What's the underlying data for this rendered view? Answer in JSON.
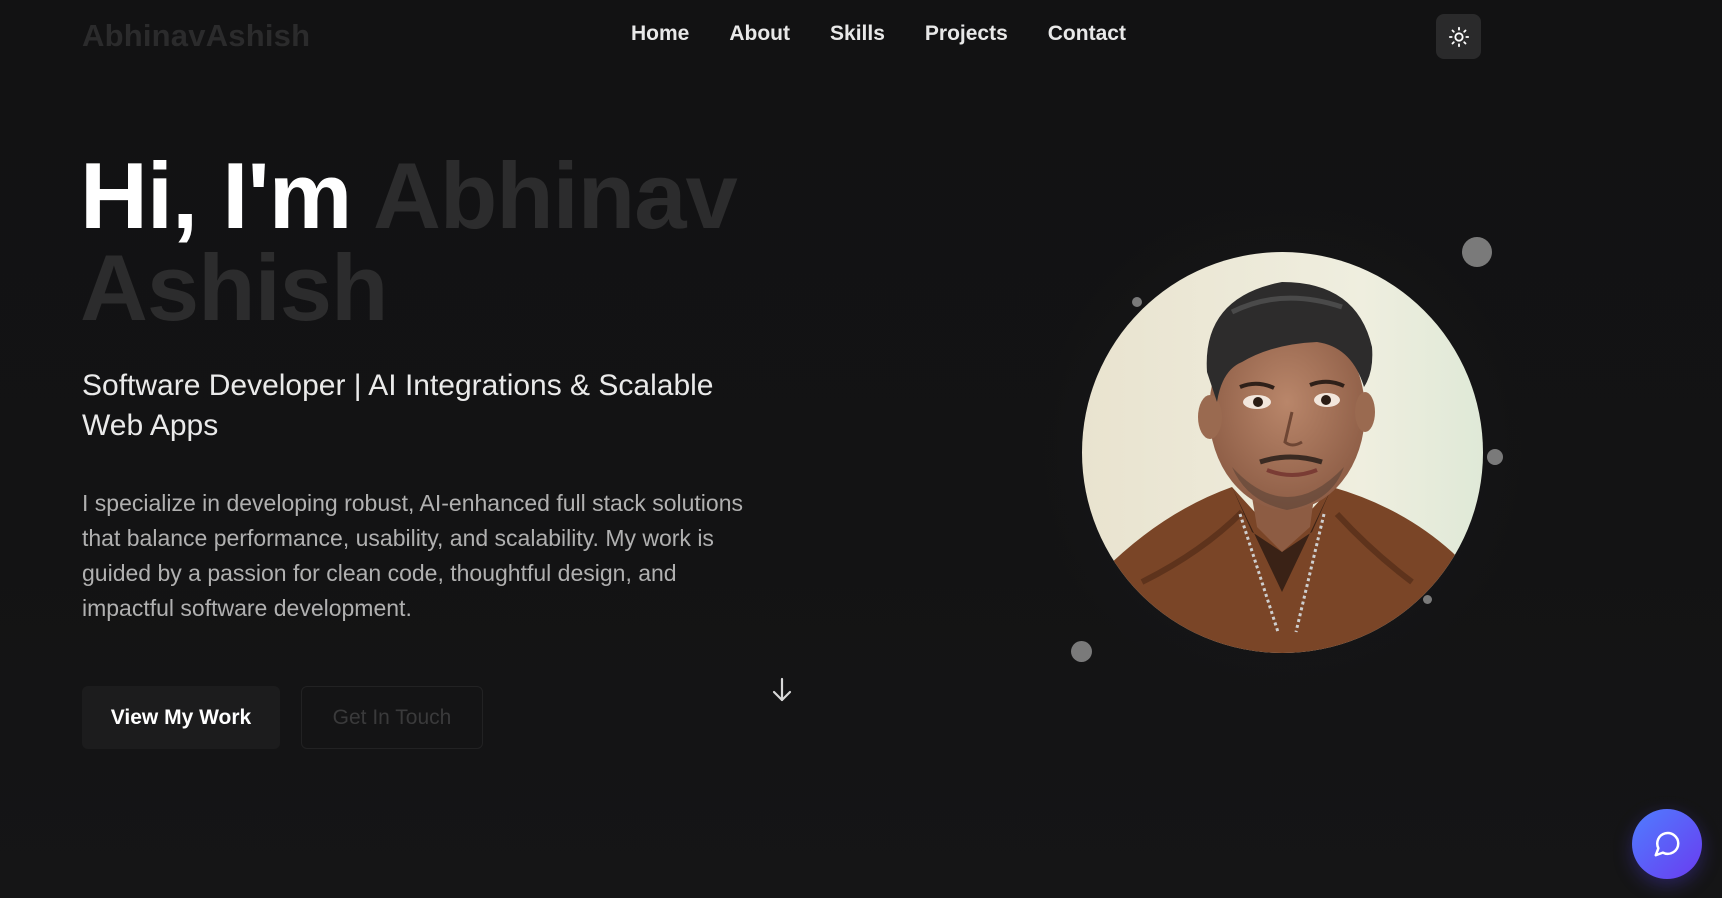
{
  "header": {
    "logo": "AbhinavAshish",
    "nav": [
      "Home",
      "About",
      "Skills",
      "Projects",
      "Contact"
    ],
    "theme_toggle_icon": "sun-icon"
  },
  "hero": {
    "greeting": "Hi, I'm",
    "name_first": "Abhinav",
    "name_last": "Ashish",
    "subtitle": "Software Developer | AI Integrations & Scalable Web Apps",
    "description": "I specialize in developing robust, AI-enhanced full stack solutions that balance performance, usability, and scalability. My work is guided by a passion for clean code, thoughtful design, and impactful software development.",
    "primary_button": "View My Work",
    "secondary_button": "Get In Touch",
    "scroll_icon": "arrow-down-icon"
  },
  "avatar": {
    "icon": "profile-photo"
  },
  "chat": {
    "icon": "chat-bubble-icon"
  },
  "colors": {
    "background": "#121213",
    "text": "#ffffff",
    "muted_name": "#2c2c2d",
    "chat_gradient_start": "#4f7dff",
    "chat_gradient_end": "#6a3cf0"
  }
}
